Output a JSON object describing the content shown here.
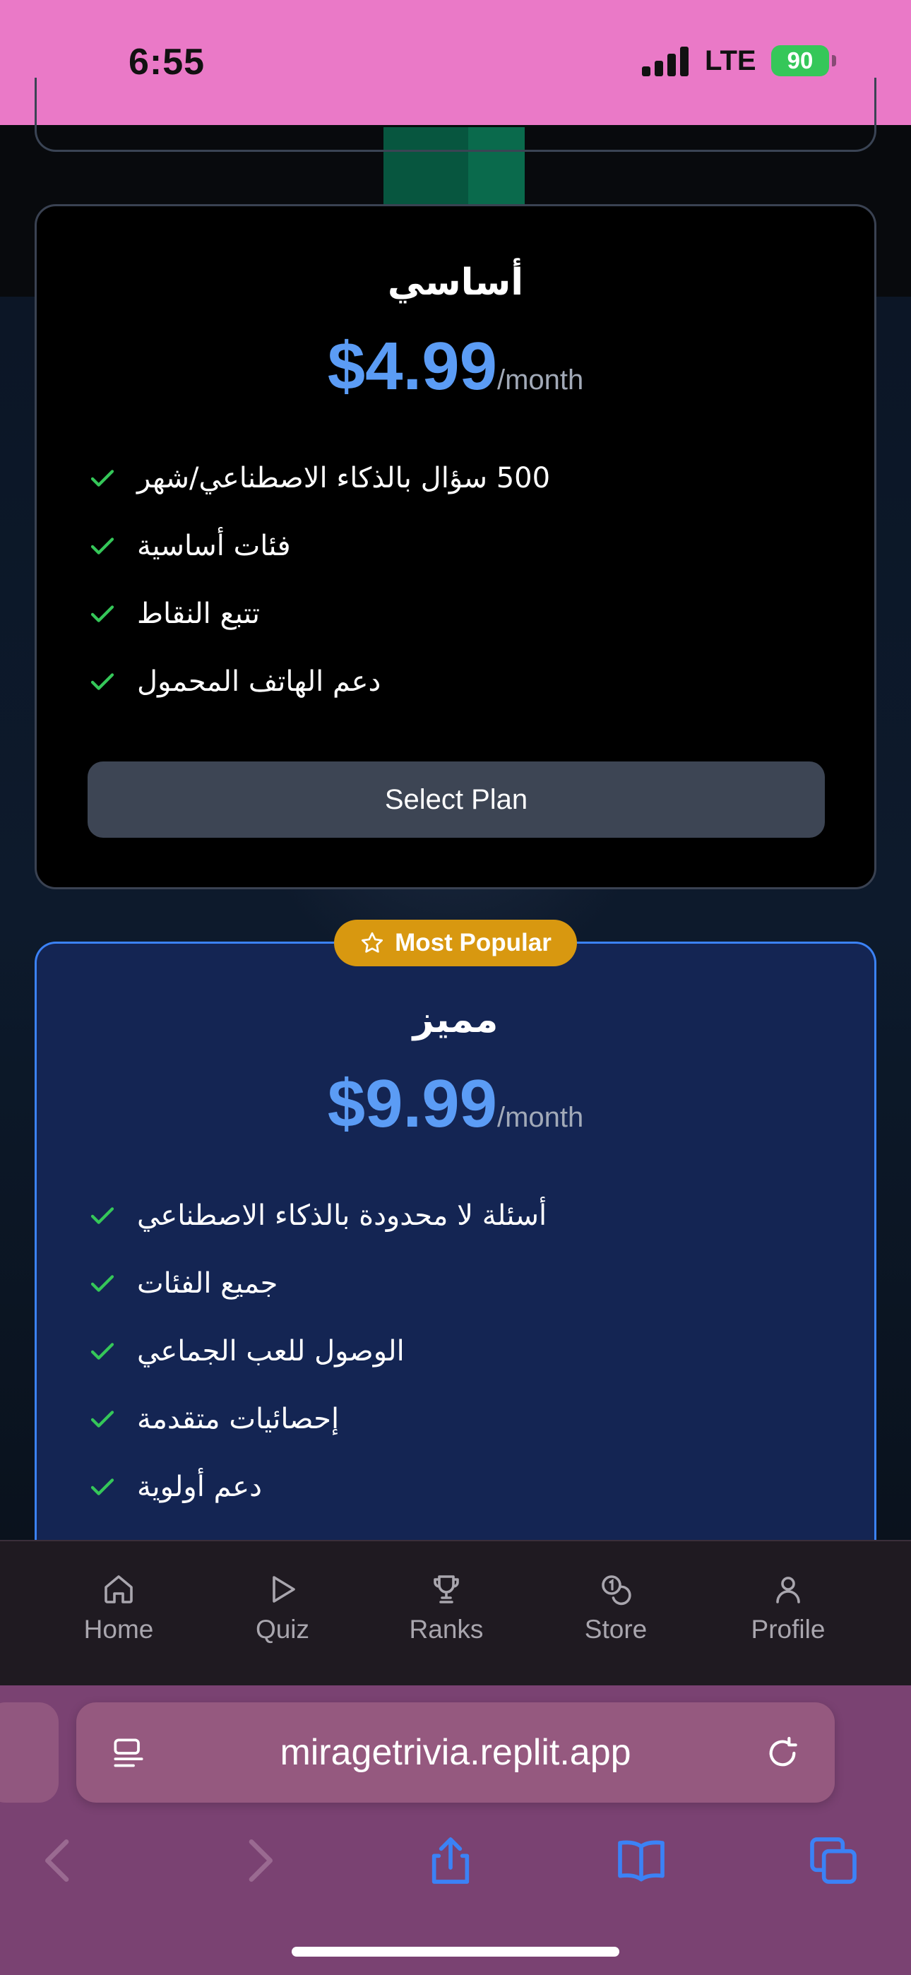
{
  "status_bar": {
    "time": "6:55",
    "network": "LTE",
    "battery": "90"
  },
  "plans": [
    {
      "name": "أساسي",
      "price": "$4.99",
      "period": "/month",
      "features": [
        "500 سؤال بالذكاء الاصطناعي/شهر",
        "فئات أساسية",
        "تتبع النقاط",
        "دعم الهاتف المحمول"
      ],
      "button": "Select Plan"
    },
    {
      "name": "مميز",
      "badge": "Most Popular",
      "price": "$9.99",
      "period": "/month",
      "features": [
        "أسئلة لا محدودة بالذكاء الاصطناعي",
        "جميع الفئات",
        "الوصول للعب الجماعي",
        "إحصائيات متقدمة",
        "دعم أولوية"
      ]
    }
  ],
  "bottom_nav": {
    "items": [
      {
        "label": "Home",
        "icon": "home-icon"
      },
      {
        "label": "Quiz",
        "icon": "play-icon"
      },
      {
        "label": "Ranks",
        "icon": "trophy-icon"
      },
      {
        "label": "Store",
        "icon": "coins-icon"
      },
      {
        "label": "Profile",
        "icon": "user-icon"
      }
    ]
  },
  "browser": {
    "url": "miragetrivia.replit.app"
  },
  "colors": {
    "status_bar": "#ea79c7",
    "accent_price": "#5b9cf5",
    "check": "#35c759",
    "badge": "#d89810",
    "premium_card": "#142553",
    "premium_border": "#3b82f6",
    "browser_chrome": "#7a4272"
  }
}
